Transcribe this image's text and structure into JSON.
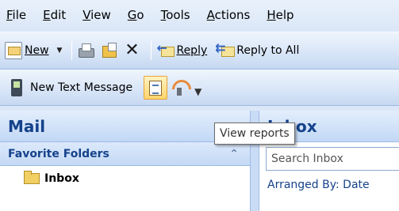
{
  "menubar": {
    "items": [
      "File",
      "Edit",
      "View",
      "Go",
      "Tools",
      "Actions",
      "Help"
    ]
  },
  "toolbar1": {
    "new_label": "New",
    "reply_label": "Reply",
    "reply_all_label": "Reply to All"
  },
  "toolbar2": {
    "new_text_message_label": "New Text Message"
  },
  "navpane": {
    "title": "Mail",
    "favorite_folders_label": "Favorite Folders",
    "folders": [
      {
        "label": "Inbox"
      }
    ]
  },
  "rightpane": {
    "title": "Inbox",
    "search_placeholder": "Search Inbox",
    "arranged_by_label": "Arranged By: Date"
  },
  "tooltip": {
    "text": "View reports"
  },
  "icons": {
    "new": "new-mail-icon",
    "print": "print-icon",
    "move": "move-to-folder-icon",
    "delete": "delete-icon",
    "reply": "reply-icon",
    "reply_all": "reply-all-icon",
    "text_message": "mobile-phone-icon",
    "reports": "reports-icon",
    "signal": "mobile-signal-icon",
    "folder": "folder-icon",
    "collapse": "collapse-chevron-icon"
  },
  "colors": {
    "accent": "#15428b",
    "highlight": "#ffd46c",
    "toolbar": "#d9e6f8"
  }
}
